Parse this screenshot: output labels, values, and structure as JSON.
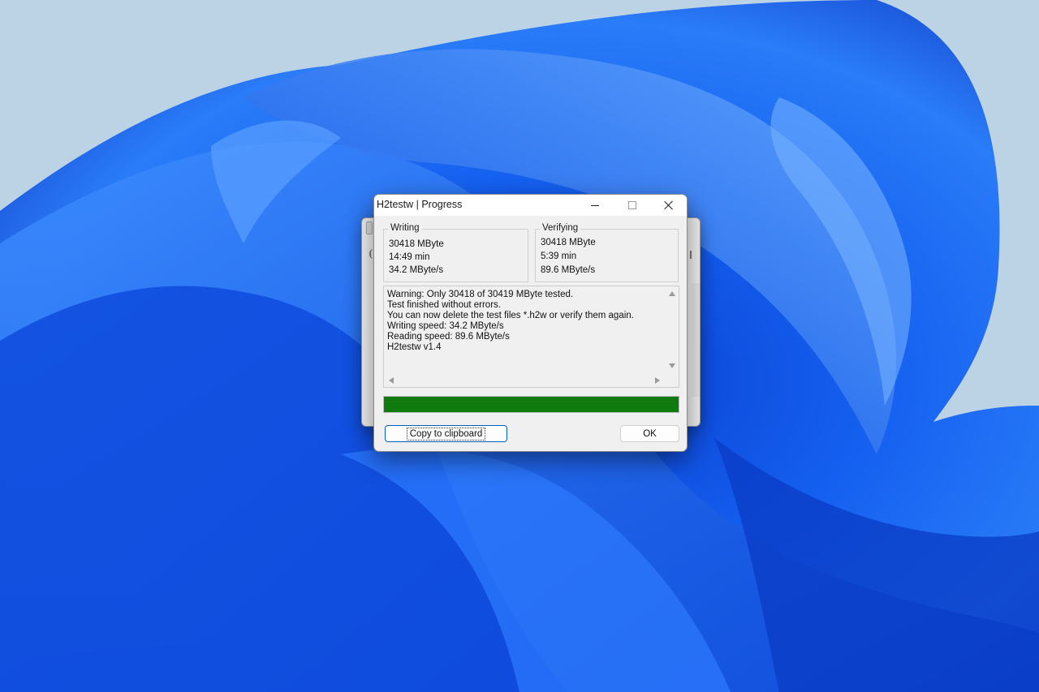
{
  "dialog": {
    "title": "H2testw | Progress",
    "writing": {
      "label": "Writing",
      "size": "30418 MByte",
      "time": "14:49 min",
      "speed": "34.2 MByte/s"
    },
    "verifying": {
      "label": "Verifying",
      "size": "30418 MByte",
      "time": "5:39 min",
      "speed": "89.6 MByte/s"
    },
    "log": [
      "Warning: Only 30418 of 30419 MByte tested.",
      "Test finished without errors.",
      "You can now delete the test files *.h2w or verify them again.",
      "Writing speed: 34.2 MByte/s",
      "Reading speed: 89.6 MByte/s",
      "H2testw v1.4"
    ],
    "progress": {
      "percent": 100,
      "color": "#0f7b0f"
    },
    "buttons": {
      "copy_label": "Copy to clipboard",
      "ok_label": "OK"
    }
  },
  "theme": {
    "wallpaper_bg": "#bcd3e6",
    "wallpaper_blue": "#1560f0",
    "accent": "#005fb8"
  }
}
